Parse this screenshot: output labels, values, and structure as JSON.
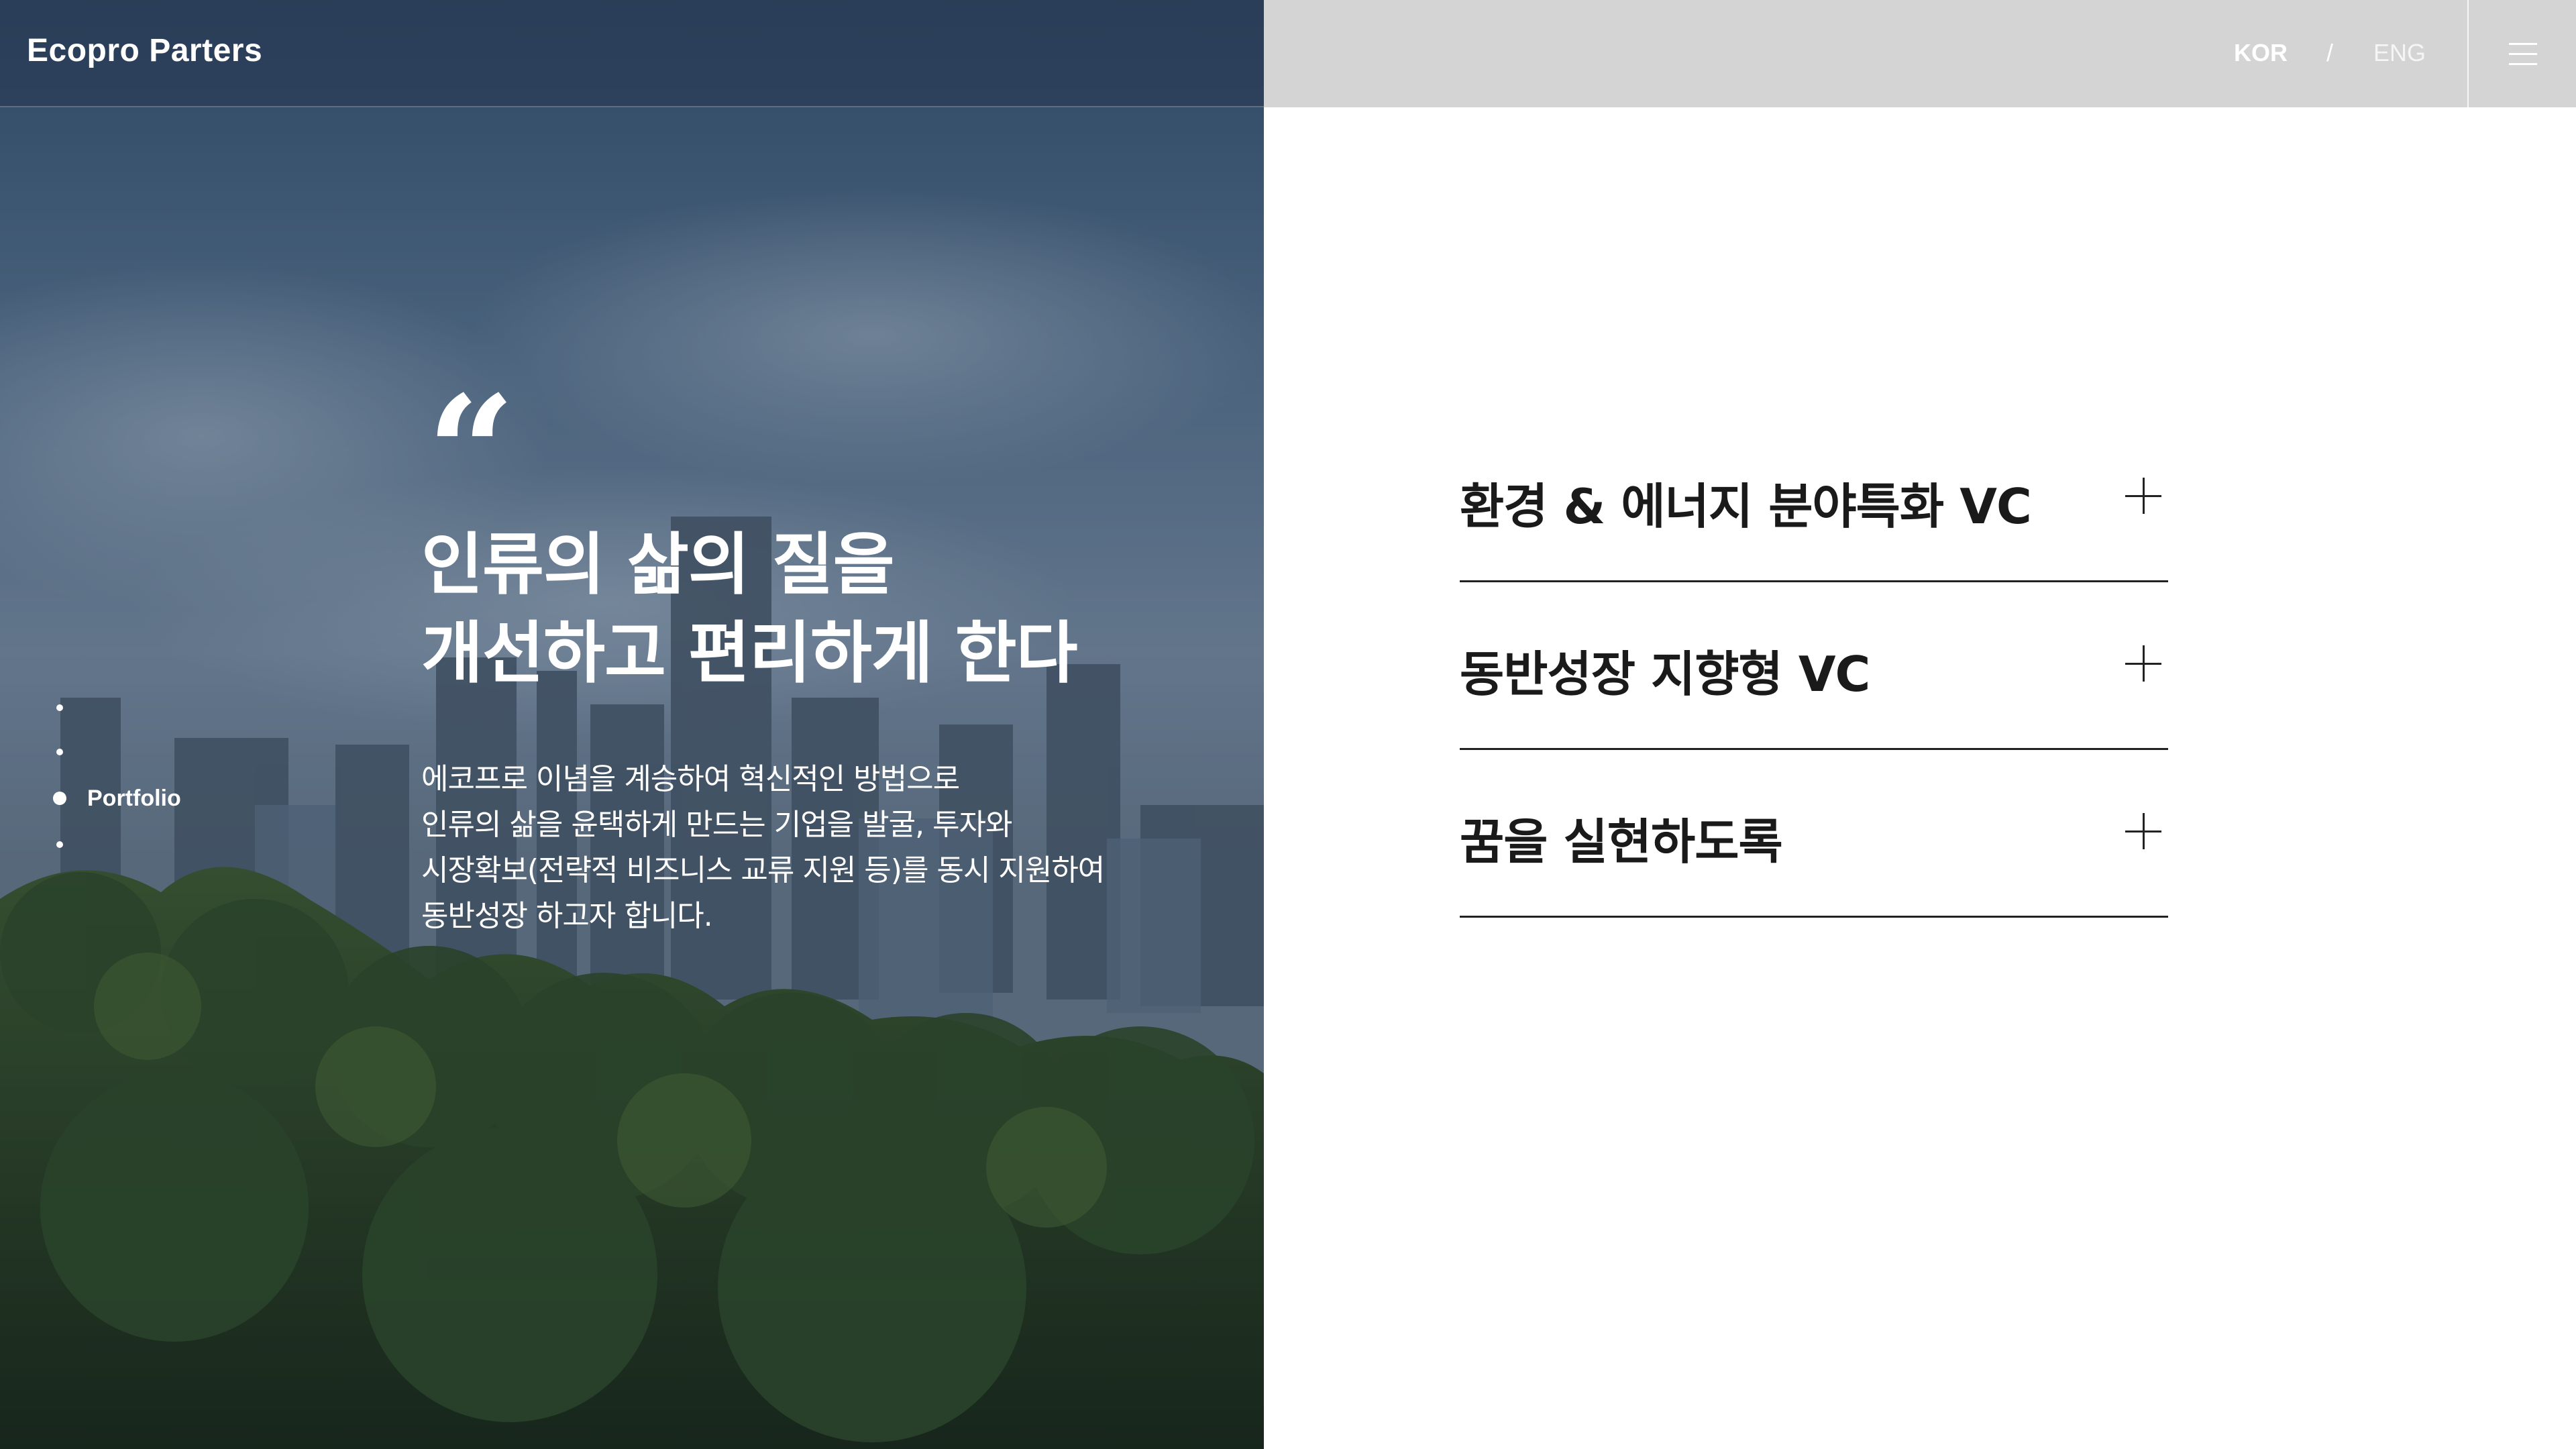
{
  "header": {
    "logo": "Ecopro Parters",
    "lang_kor": "KOR",
    "lang_separator": "/",
    "lang_eng": "ENG",
    "menu_icon": "hamburger-menu-icon"
  },
  "hero": {
    "quote_mark": "“",
    "headline_lines": [
      "인류의 삶의 질을",
      "개선하고 편리하게 한다"
    ],
    "description_lines": [
      "에코프로 이념을 계승하여 혁신적인 방법으로",
      " 인류의 삶을 윤택하게 만드는 기업을 발굴, 투자와",
      "시장확보(전략적 비즈니스 교류 지원 등)를 동시 지원하여",
      "동반성장 하고자 합니다."
    ]
  },
  "side_nav": {
    "active_label": "Portfolio"
  },
  "accordion": {
    "items": [
      {
        "title": "환경 & 에너지 분야특화 VC",
        "icon": "plus-icon"
      },
      {
        "title": "동반성장 지향형 VC",
        "icon": "plus-icon"
      },
      {
        "title": "꿈을 실현하도록",
        "icon": "plus-icon"
      }
    ]
  }
}
